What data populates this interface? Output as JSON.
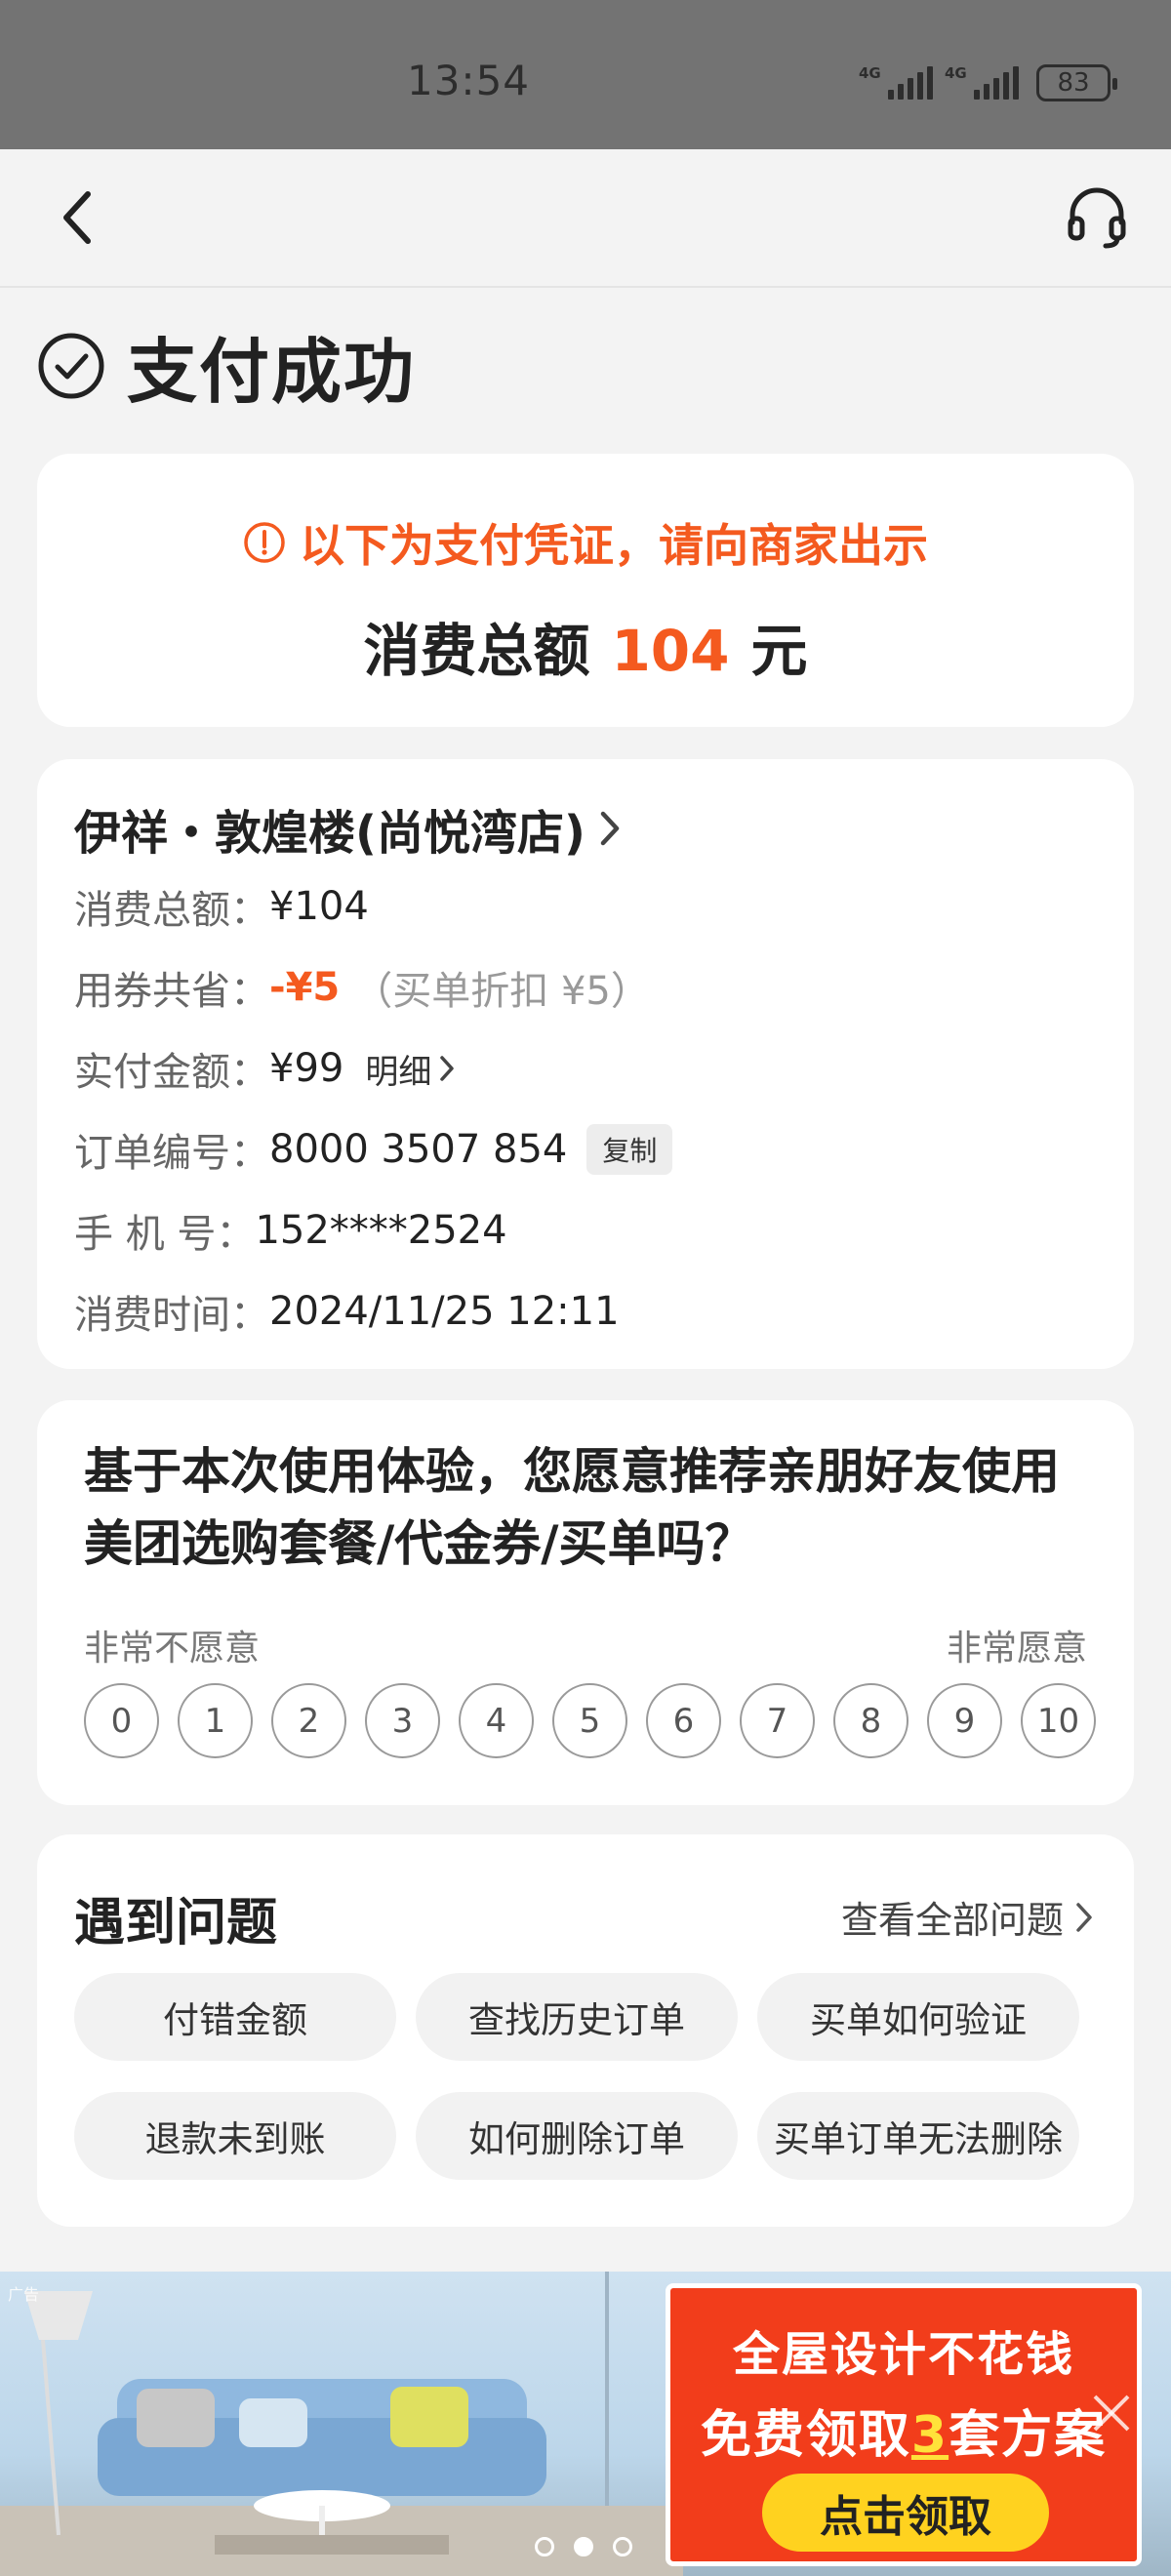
{
  "status_bar": {
    "time": "13:54",
    "network_1": "4G",
    "network_2": "4G",
    "battery": "83"
  },
  "nav": {
    "back_icon": "chevron-left-icon",
    "service_icon": "headset-icon"
  },
  "page": {
    "title": "支付成功",
    "title_icon": "check-circle-icon"
  },
  "voucher": {
    "notice": "以下为支付凭证，请向商家出示",
    "total_label": "消费总额",
    "total_amount": "104",
    "total_unit": "元",
    "accent_color": "#f45a1f"
  },
  "order": {
    "shop_name": "伊祥・敦煌楼(尚悦湾店)",
    "rows": {
      "total": {
        "label": "消费总额：",
        "value": "¥104"
      },
      "saved": {
        "label": "用券共省：",
        "value": "-¥5",
        "note": "（买单折扣 ¥5）"
      },
      "paid": {
        "label": "实付金额：",
        "value": "¥99",
        "link": "明细"
      },
      "order_no": {
        "label": "订单编号：",
        "value": "8000 3507 854",
        "action": "复制"
      },
      "phone": {
        "label": "手 机 号：",
        "value": "152****2524"
      },
      "time": {
        "label": "消费时间：",
        "value": "2024/11/25 12:11"
      }
    }
  },
  "survey": {
    "question": "基于本次使用体验，您愿意推荐亲朋好友使用美团选购套餐/代金券/买单吗？",
    "low_label": "非常不愿意",
    "high_label": "非常愿意",
    "scores": [
      "0",
      "1",
      "2",
      "3",
      "4",
      "5",
      "6",
      "7",
      "8",
      "9",
      "10"
    ]
  },
  "help": {
    "title": "遇到问题",
    "view_all": "查看全部问题",
    "questions": [
      "付错金额",
      "查找历史订单",
      "买单如何验证",
      "退款未到账",
      "如何删除订单",
      "买单订单无法删除"
    ]
  },
  "ad": {
    "tag": "广告",
    "line1": "全屋设计不花钱",
    "line2_prefix": "免费领取",
    "line2_highlight": "3",
    "line2_suffix": "套方案",
    "cta": "点击领取",
    "panel_color": "#f23d1b",
    "cta_color": "#ffd21f",
    "pages": 3,
    "active_page": 2
  }
}
